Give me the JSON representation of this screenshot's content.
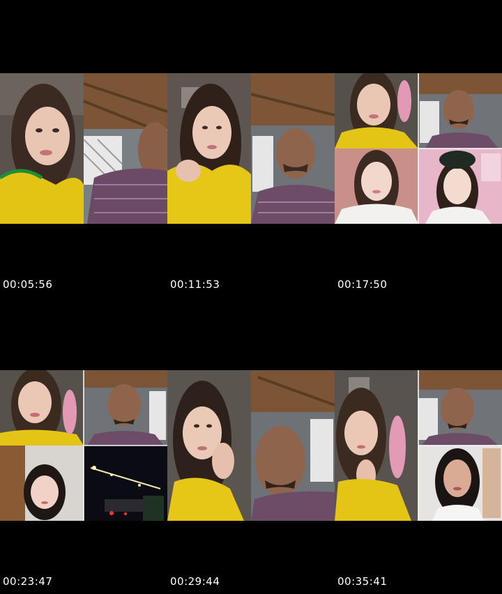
{
  "contact_sheet": {
    "timestamps": [
      "00:05:56",
      "00:11:53",
      "00:17:50",
      "00:23:47",
      "00:29:44",
      "00:35:41"
    ]
  }
}
